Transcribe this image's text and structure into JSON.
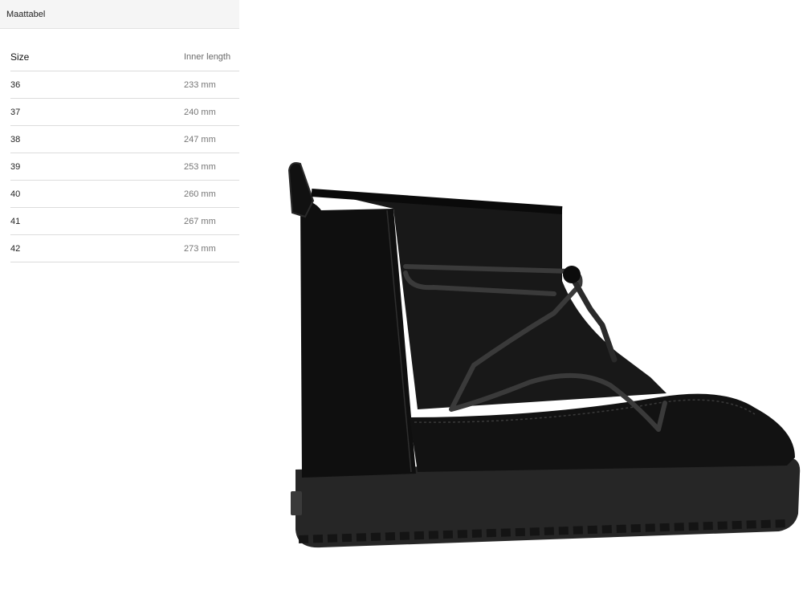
{
  "panel": {
    "title": "Maattabel",
    "headers": {
      "size": "Size",
      "length": "Inner length"
    },
    "rows": [
      {
        "size": "36",
        "length": "233 mm"
      },
      {
        "size": "37",
        "length": "240 mm"
      },
      {
        "size": "38",
        "length": "247 mm"
      },
      {
        "size": "39",
        "length": "253 mm"
      },
      {
        "size": "40",
        "length": "260 mm"
      },
      {
        "size": "41",
        "length": "267 mm"
      },
      {
        "size": "42",
        "length": "273 mm"
      }
    ]
  },
  "product_image": {
    "icon": "black-suede-lace-up-boot"
  }
}
